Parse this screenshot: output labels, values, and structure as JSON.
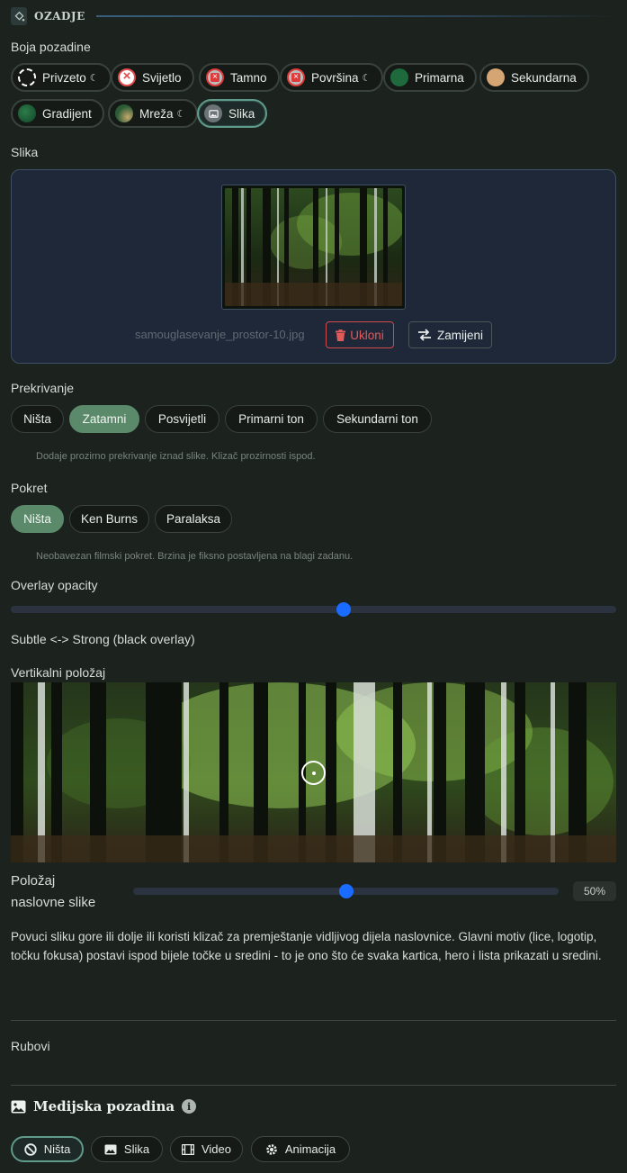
{
  "section": {
    "title": "OZADJE",
    "icon": "paint-bucket-icon"
  },
  "background_color": {
    "label": "Boja pozadine",
    "options": [
      {
        "label": "Privzeto",
        "icon": "dashed-circle-icon",
        "dark_mode": true
      },
      {
        "label": "Svijetlo",
        "icon": "light-swatch-icon",
        "dark_mode": false
      },
      {
        "label": "Tamno",
        "icon": "dark-swatch-icon",
        "dark_mode": false
      },
      {
        "label": "Površina",
        "icon": "surface-swatch-icon",
        "dark_mode": true
      },
      {
        "label": "Primarna",
        "icon": "primary-swatch-icon",
        "color": "#1e6a3c",
        "dark_mode": false
      },
      {
        "label": "Sekundarna",
        "icon": "secondary-swatch-icon",
        "color": "#d6a574",
        "dark_mode": false
      },
      {
        "label": "Gradijent",
        "icon": "gradient-swatch-icon",
        "dark_mode": false
      },
      {
        "label": "Mreža",
        "icon": "mesh-swatch-icon",
        "dark_mode": true
      },
      {
        "label": "Slika",
        "icon": "image-swatch-icon",
        "dark_mode": false,
        "selected": true
      }
    ],
    "moon_glyph": "☾"
  },
  "image": {
    "label": "Slika",
    "filename": "samouglasevanje_prostor-10.jpg",
    "remove_label": "Ukloni",
    "replace_label": "Zamijeni"
  },
  "overlay": {
    "label": "Prekrivanje",
    "options": [
      "Ništa",
      "Zatamni",
      "Posvijetli",
      "Primarni ton",
      "Sekundarni ton"
    ],
    "selected": "Zatamni",
    "hint": "Dodaje prozirno prekrivanje iznad slike. Klizač prozirnosti ispod."
  },
  "motion": {
    "label": "Pokret",
    "options": [
      "Ništa",
      "Ken Burns",
      "Paralaksa"
    ],
    "selected": "Ništa",
    "hint": "Neobavezan filmski pokret. Brzina je fiksno postavljena na blagi zadanu."
  },
  "overlay_opacity": {
    "label": "Overlay opacity",
    "value": 0.55,
    "caption": "Subtle <-> Strong (black overlay)"
  },
  "vertical_position": {
    "label": "Vertikalni položaj",
    "slider_label_line1": "Položaj",
    "slider_label_line2": "naslovne slike",
    "value": 50,
    "value_text": "50%",
    "description": "Povuci sliku gore ili dolje ili koristi klizač za premještanje vidljivog dijela naslovnice. Glavni motiv (lice, logotip, točku fokusa) postavi ispod bijele točke u sredini - to je ono što će svaka kartica, hero i lista prikazati u sredini."
  },
  "edges": {
    "label": "Rubovi"
  },
  "media_background": {
    "title": "Medijska pozadina",
    "info_glyph": "i",
    "options": [
      {
        "label": "Ništa",
        "icon": "ban-icon",
        "selected": true
      },
      {
        "label": "Slika",
        "icon": "image-icon"
      },
      {
        "label": "Video",
        "icon": "film-icon"
      },
      {
        "label": "Animacija",
        "icon": "gear-icon"
      }
    ]
  },
  "colors": {
    "accent": "#1a6bff",
    "selected_pill": "#5b8a6a",
    "danger": "#d24a4a",
    "background": "#1c231e"
  }
}
